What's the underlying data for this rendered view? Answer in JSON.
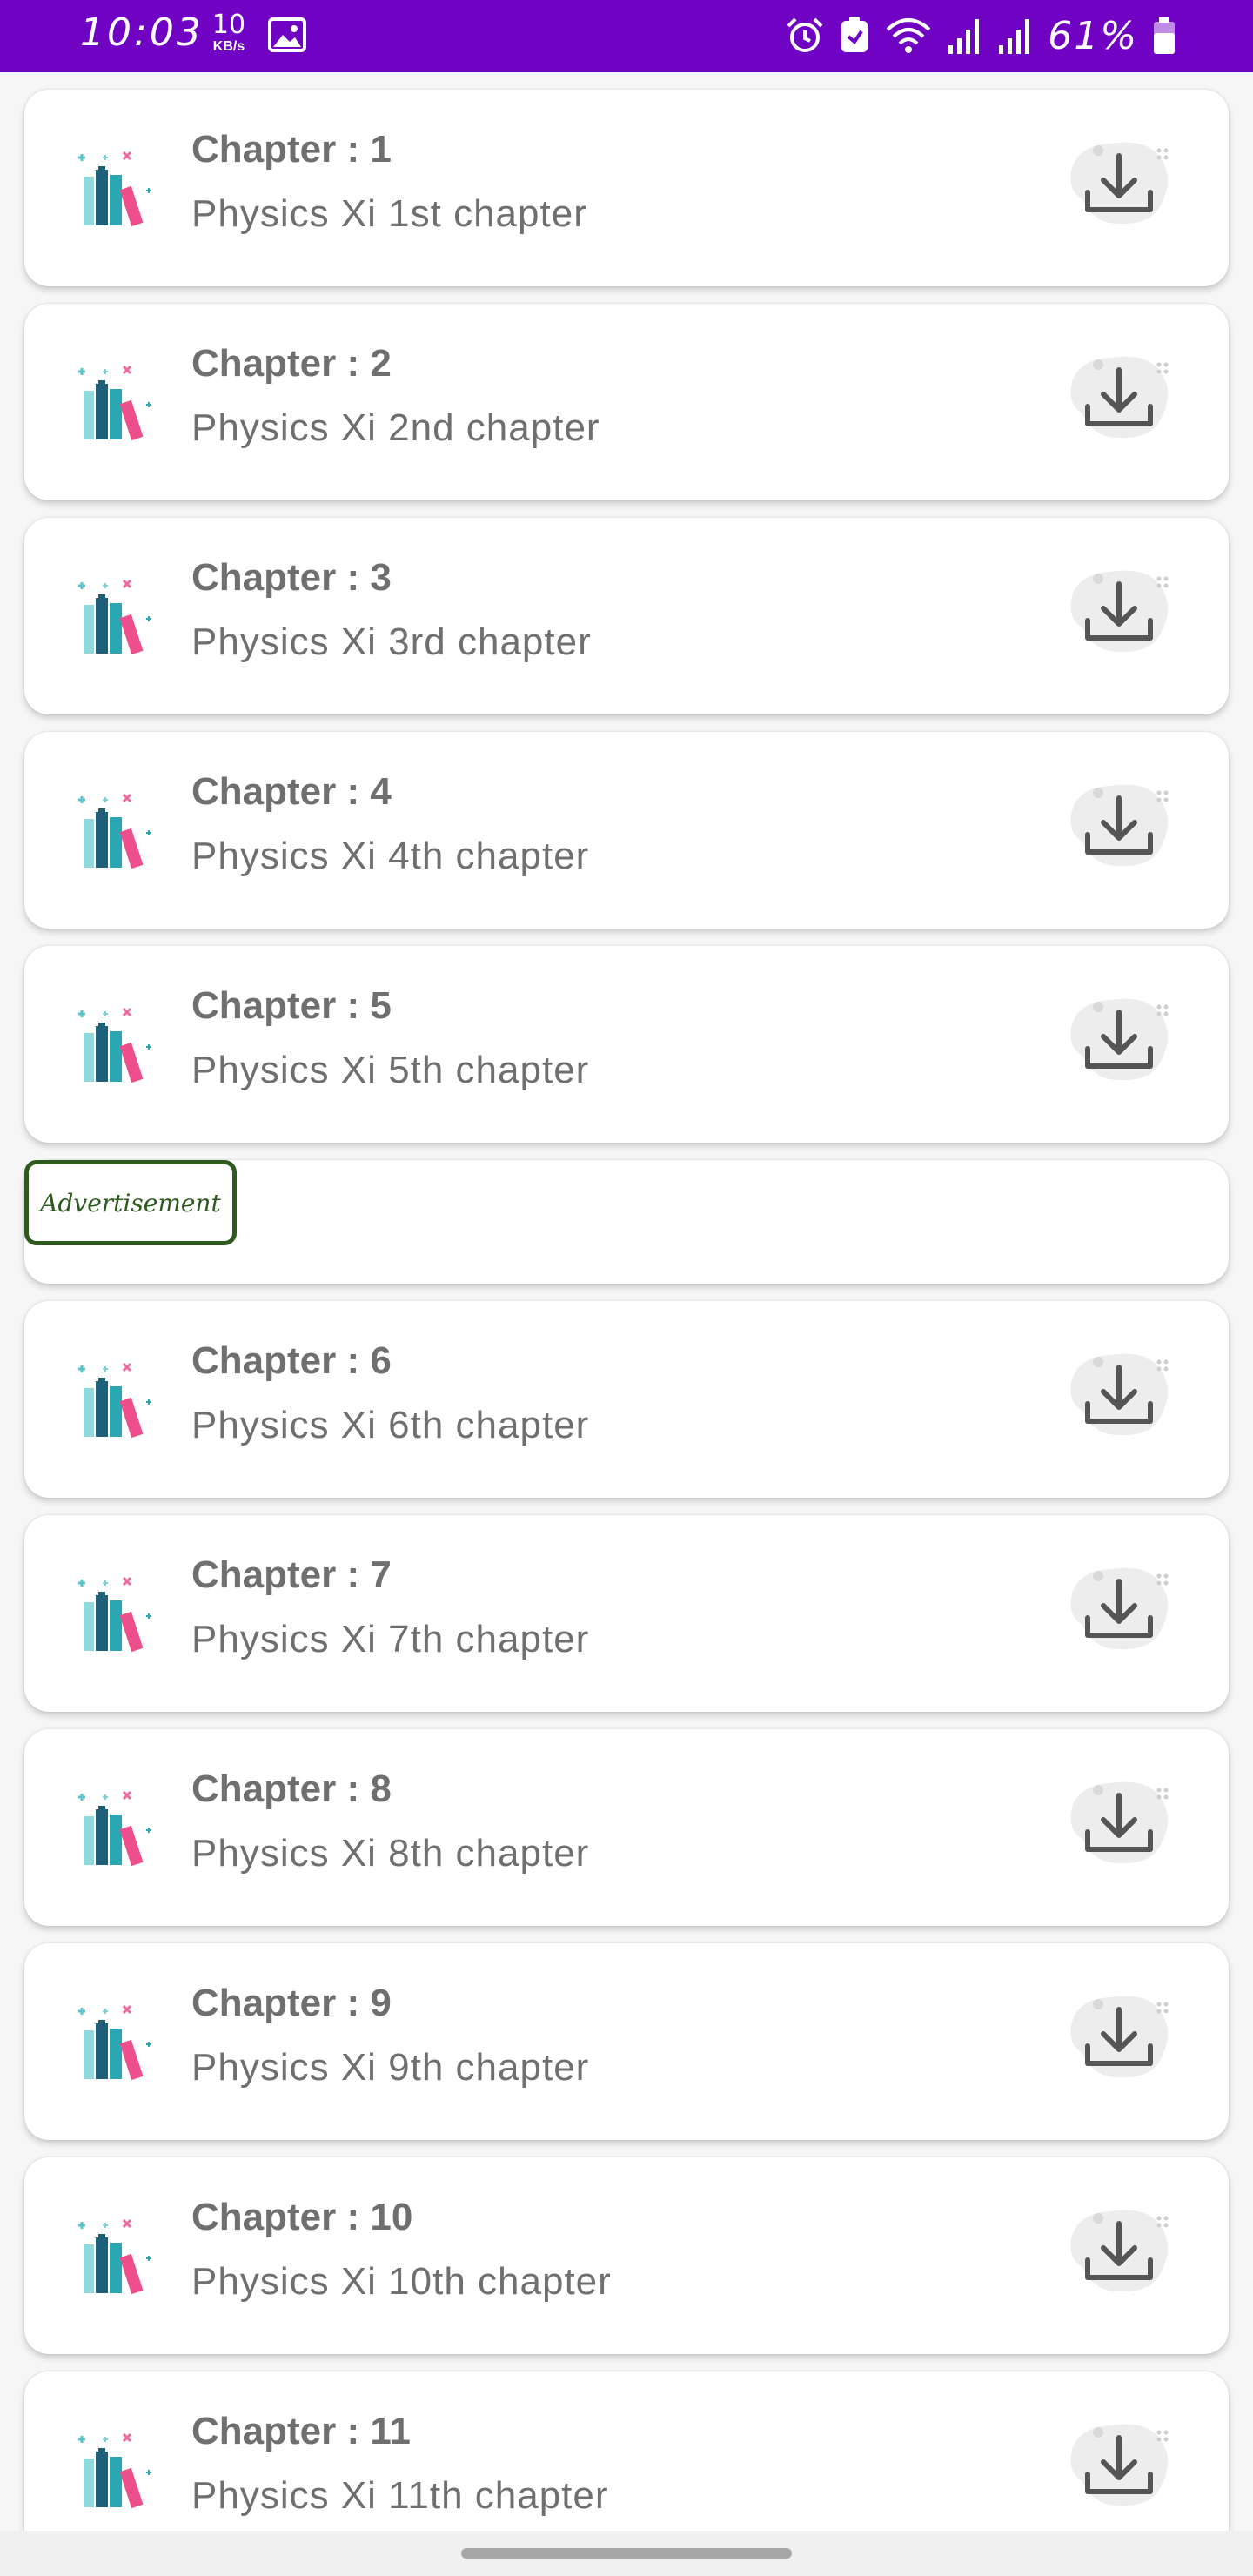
{
  "status_bar": {
    "time": "10:03",
    "net_speed_value": "10",
    "net_speed_unit": "KB/s",
    "battery": "61%",
    "icons": [
      "gallery-icon",
      "alarm-icon",
      "nfc-icon",
      "wifi-icon",
      "signal-icon",
      "signal-icon",
      "battery-icon"
    ]
  },
  "chapters": [
    {
      "title": "Chapter : 1",
      "subtitle": "Physics Xi 1st chapter"
    },
    {
      "title": "Chapter : 2",
      "subtitle": "Physics Xi 2nd chapter"
    },
    {
      "title": "Chapter : 3",
      "subtitle": "Physics Xi 3rd chapter"
    },
    {
      "title": "Chapter : 4",
      "subtitle": "Physics Xi 4th chapter"
    },
    {
      "title": "Chapter : 5",
      "subtitle": "Physics Xi 5th chapter"
    },
    {
      "title": "Chapter : 6",
      "subtitle": "Physics Xi 6th chapter"
    },
    {
      "title": "Chapter : 7",
      "subtitle": "Physics Xi 7th chapter"
    },
    {
      "title": "Chapter : 8",
      "subtitle": "Physics Xi 8th chapter"
    },
    {
      "title": "Chapter : 9",
      "subtitle": "Physics Xi 9th chapter"
    },
    {
      "title": "Chapter : 10",
      "subtitle": "Physics Xi 10th chapter"
    },
    {
      "title": "Chapter : 11",
      "subtitle": "Physics Xi 11th chapter"
    }
  ],
  "ad": {
    "label": "Advertisement"
  },
  "colors": {
    "status_bar": "#6f02c3",
    "text": "#6f6f6f",
    "ad_border": "#2e5a1f"
  }
}
